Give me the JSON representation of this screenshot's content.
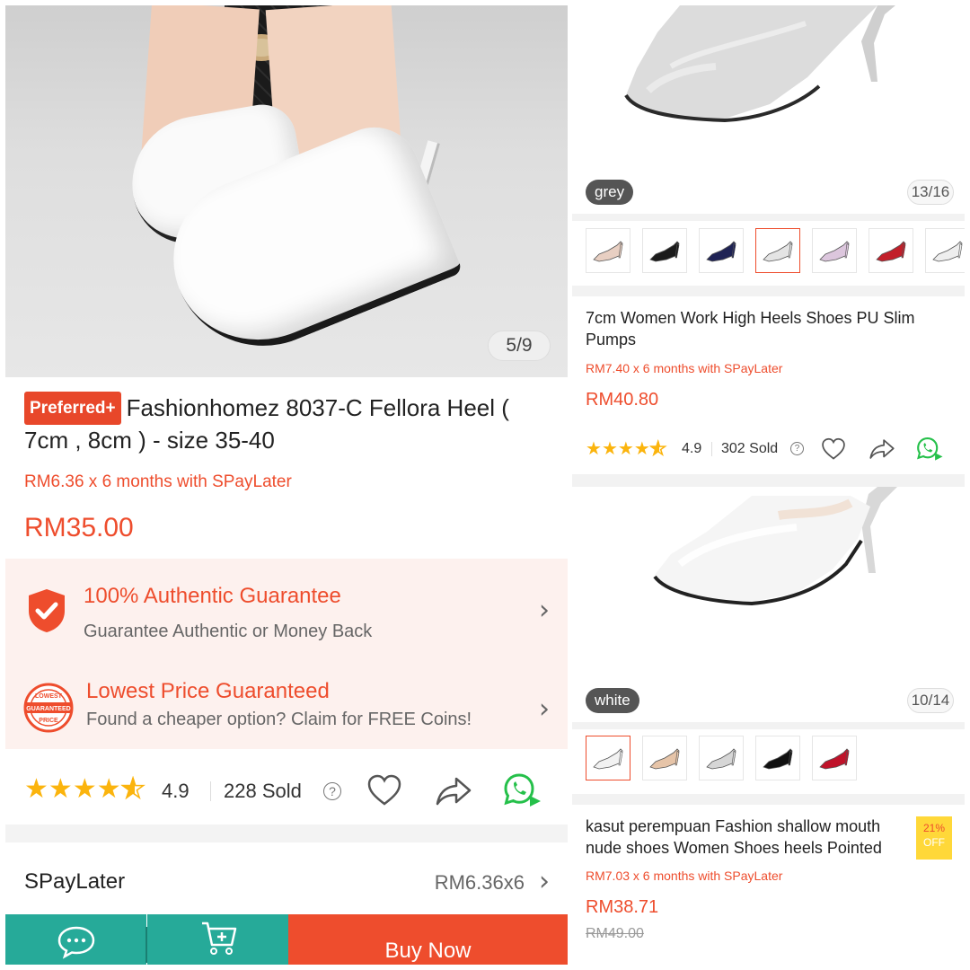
{
  "left": {
    "image_counter": "5/9",
    "badge": "Preferred+",
    "title": "Fashionhomez 8037-C Fellora Heel ( 7cm , 8cm ) - size 35-40",
    "spaylater": "RM6.36 x 6 months with SPayLater",
    "price": "RM35.00",
    "guarantee": {
      "authentic_title": "100% Authentic Guarantee",
      "authentic_sub": "Guarantee Authentic or Money Back",
      "lowest_title": "Lowest Price Guaranteed",
      "lowest_sub": "Found a cheaper option? Claim for FREE Coins!",
      "lowest_icon_text_top": "LOWEST",
      "lowest_icon_text_mid": "GUARANTEED",
      "lowest_icon_text_bot": "PRICE"
    },
    "rating": "4.9",
    "rating_value": 4.5,
    "sold": "228 Sold",
    "spay_row": {
      "label": "SPayLater",
      "value": "RM6.36x6"
    },
    "bottom": {
      "buy_now": "Buy Now"
    }
  },
  "right": {
    "product1": {
      "variant": "grey",
      "image_counter": "13/16",
      "thumb_colors": [
        "#e8cfc2",
        "#1b1b1b",
        "#1f2355",
        "#e4e4e4",
        "#dcc6dd",
        "#c21f2a",
        "#eeeeee"
      ],
      "selected_thumb": 3,
      "title": "7cm Women Work High Heels Shoes PU Slim Pumps",
      "spaylater": "RM7.40 x 6 months with SPayLater",
      "price": "RM40.80",
      "rating": "4.9",
      "rating_value": 4.5,
      "sold": "302 Sold"
    },
    "product2": {
      "variant": "white",
      "image_counter": "10/14",
      "thumb_colors": [
        "#f2f2f2",
        "#e6c4a8",
        "#d6d6d6",
        "#111111",
        "#c0132a"
      ],
      "selected_thumb": 0,
      "title": "kasut perempuan Fashion shallow mouth nude shoes Women Shoes heels Pointed",
      "discount_pct": "21%",
      "discount_off": "OFF",
      "spaylater": "RM7.03 x 6 months with SPayLater",
      "price": "RM38.71",
      "old_price": "RM49.00"
    }
  },
  "colors": {
    "accent": "#ee4d2d",
    "teal": "#26aa99",
    "star": "#fbb40d",
    "whatsapp": "#25c04a"
  }
}
